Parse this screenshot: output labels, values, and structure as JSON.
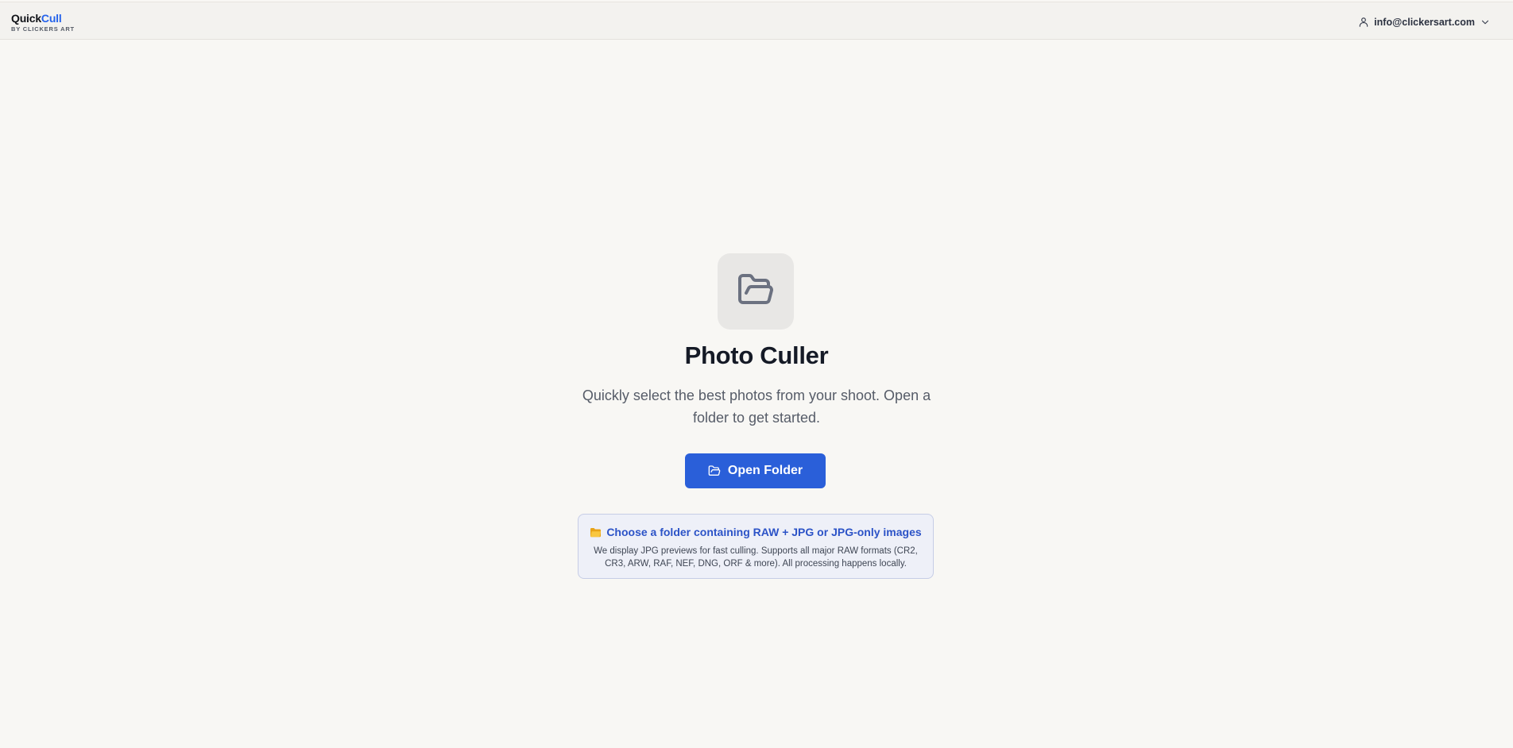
{
  "brand": {
    "name_part1": "Quick",
    "name_part2": "Cull",
    "subtitle": "BY CLICKERS ART",
    "accent_color": "#2563eb"
  },
  "user": {
    "email": "info@clickersart.com",
    "icon": "user-icon",
    "menu_icon": "chevron-down-icon"
  },
  "hero": {
    "icon": "folder-open-icon",
    "title": "Photo Culler",
    "subtitle": "Quickly select the best photos from your shoot. Open a folder to get started.",
    "button_label": "Open Folder",
    "button_icon": "folder-open-icon",
    "button_color": "#2a5fd9"
  },
  "info": {
    "icon": "folder-emoji-icon",
    "heading": "Choose a folder containing RAW + JPG or JPG-only images",
    "body": "We display JPG previews for fast culling. Supports all major RAW formats (CR2, CR3, ARW, RAF, NEF, DNG, ORF & more). All processing happens locally."
  }
}
